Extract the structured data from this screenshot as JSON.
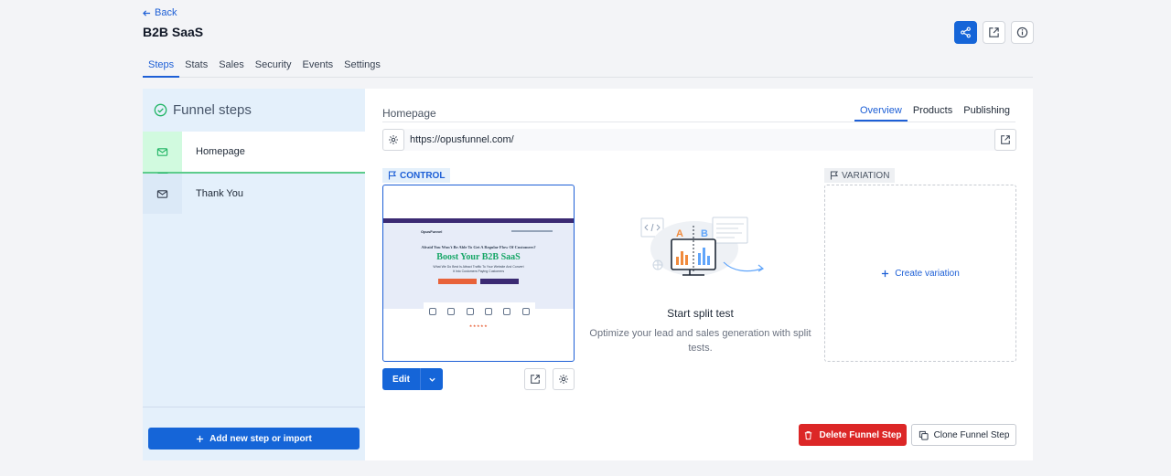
{
  "header": {
    "back_label": "Back",
    "title": "B2B SaaS"
  },
  "tabs": [
    {
      "label": "Steps",
      "active": true
    },
    {
      "label": "Stats"
    },
    {
      "label": "Sales"
    },
    {
      "label": "Security"
    },
    {
      "label": "Events"
    },
    {
      "label": "Settings"
    }
  ],
  "sidebar": {
    "title": "Funnel steps",
    "steps": [
      {
        "label": "Homepage",
        "icon": "mail-icon",
        "active": true
      },
      {
        "label": "Thank You",
        "icon": "mail-icon"
      }
    ],
    "add_button": "Add new step or import"
  },
  "main": {
    "breadcrumb": "Homepage",
    "tabs": [
      {
        "label": "Overview",
        "active": true
      },
      {
        "label": "Products"
      },
      {
        "label": "Publishing"
      }
    ],
    "url": "https://opusfunnel.com/",
    "control_label": "CONTROL",
    "variation_label": "VARIATION",
    "preview": {
      "logo": "OpusFunnel",
      "heading_small": "Afraid You Won't Be Able To Get A Regular Flow Of Customers?",
      "heading_big": "Boost Your B2B SaaS",
      "sub_1": "What We Do Best Is Attract Traffic To Your Website And Convert",
      "sub_2": "It Into Customers Paying Customers",
      "stars": "★★★★★"
    },
    "edit_label": "Edit",
    "split": {
      "title": "Start split test",
      "subtitle": "Optimize your lead and sales generation with split tests."
    },
    "create_variation": "Create variation",
    "delete_step": "Delete Funnel Step",
    "clone_step": "Clone Funnel Step"
  },
  "colors": {
    "primary": "#1565d8",
    "danger": "#dc2626",
    "success": "#22b566",
    "sidebar_bg": "#e4f0fb"
  }
}
